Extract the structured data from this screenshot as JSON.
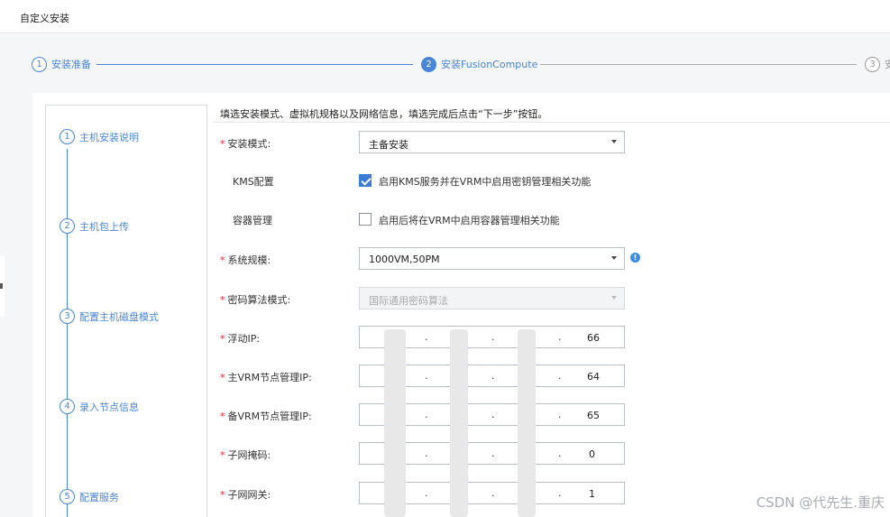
{
  "page_title": "自定义安装",
  "steps": [
    {
      "num": "1",
      "label": "安装准备",
      "state": "done"
    },
    {
      "num": "2",
      "label": "安装FusionCompute",
      "state": "active"
    },
    {
      "num": "3",
      "label": "安",
      "state": "todo"
    }
  ],
  "subnav": [
    {
      "num": "1",
      "label": "主机安装说明"
    },
    {
      "num": "2",
      "label": "主机包上传"
    },
    {
      "num": "3",
      "label": "配置主机磁盘模式"
    },
    {
      "num": "4",
      "label": "录入节点信息"
    },
    {
      "num": "5",
      "label": "配置服务"
    }
  ],
  "hint": "填选安装模式、虚拟机规格以及网络信息，填选完成后点击“下一步”按钮。",
  "form": {
    "install_mode": {
      "label": "安装模式:",
      "value": "主备安装"
    },
    "kms": {
      "label": "KMS配置",
      "checked": true,
      "text": "启用KMS服务并在VRM中启用密钥管理相关功能"
    },
    "container": {
      "label": "容器管理",
      "checked": false,
      "text": "启用后将在VRM中启用容器管理相关功能"
    },
    "scale": {
      "label": "系统规模:",
      "value": "1000VM,50PM"
    },
    "crypto": {
      "label": "密码算法模式:",
      "value": "国际通用密码算法"
    },
    "float_ip": {
      "label": "浮动IP:",
      "last": "66"
    },
    "main_vrm_ip": {
      "label": "主VRM节点管理IP:",
      "last": "64"
    },
    "backup_vrm_ip": {
      "label": "备VRM节点管理IP:",
      "last": "65"
    },
    "netmask": {
      "label": "子网掩码:",
      "last": "0"
    },
    "gateway": {
      "label": "子网网关:",
      "last": "1"
    }
  },
  "watermark": "CSDN @代先生.重庆",
  "colors": {
    "accent": "#4a86d8",
    "required": "#e23333",
    "info": "#3a8ee6"
  }
}
